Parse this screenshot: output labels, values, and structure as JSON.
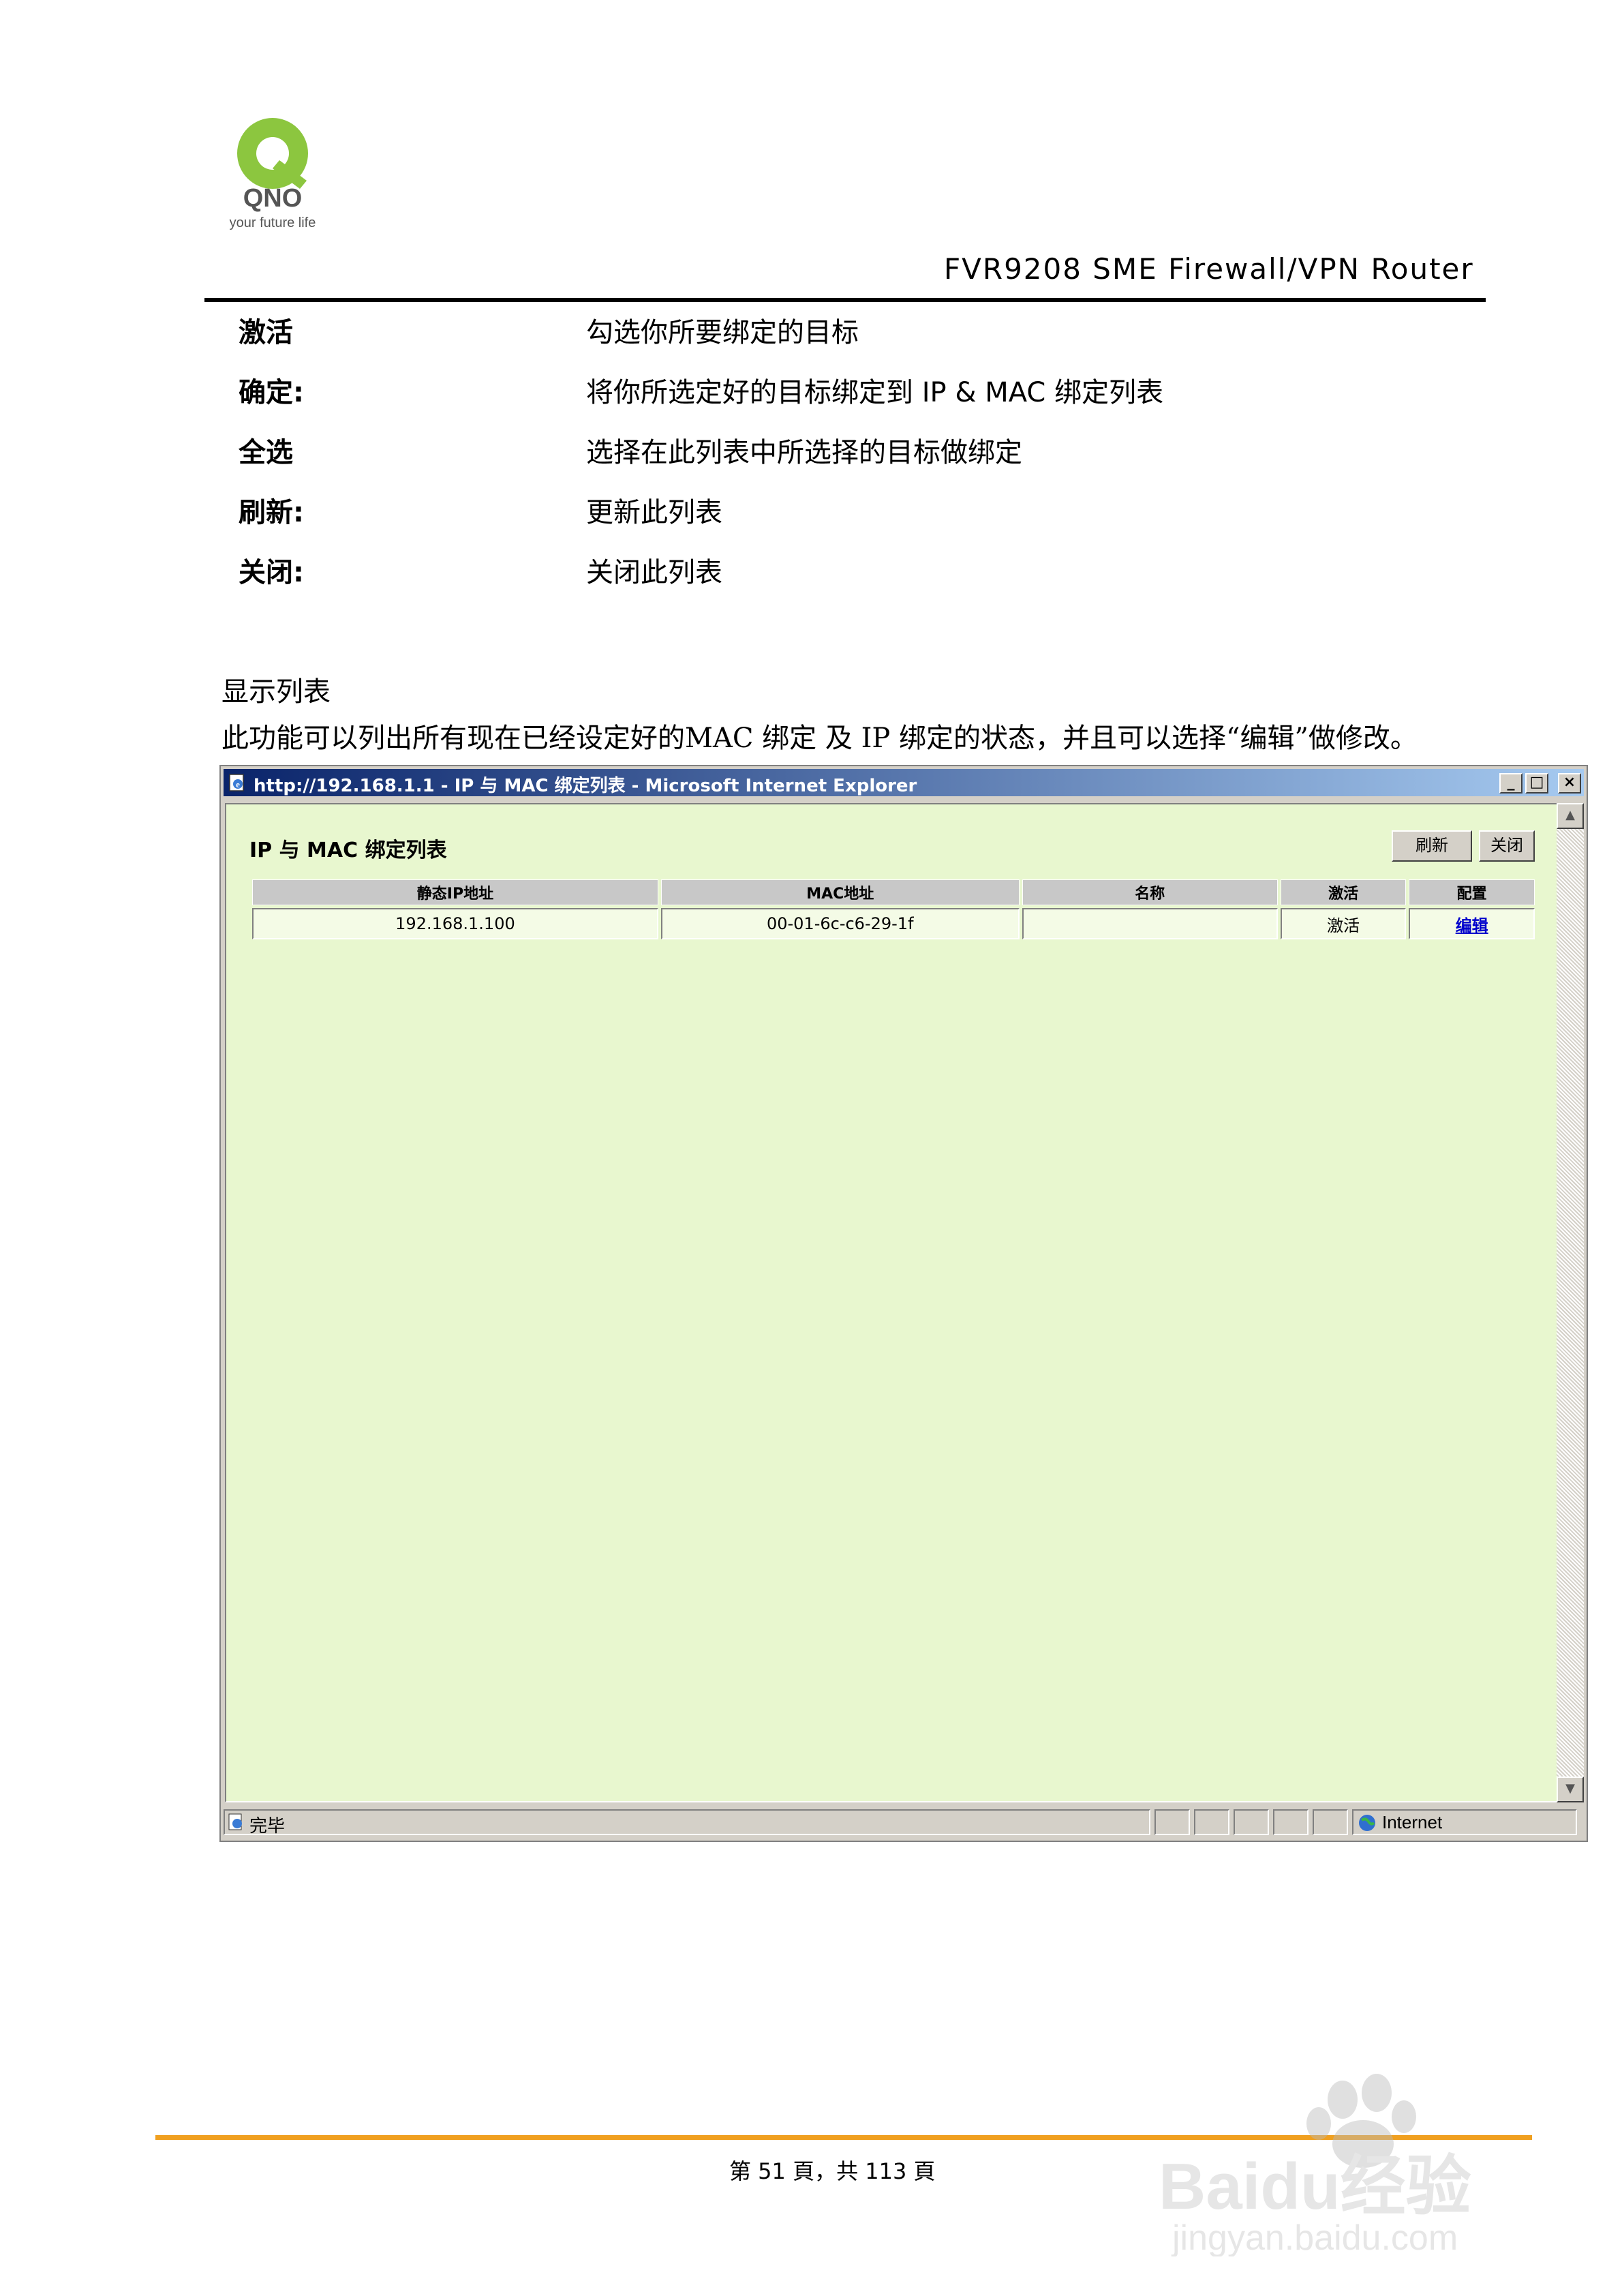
{
  "logo": {
    "brand": "QNO",
    "tagline": "your future life"
  },
  "header": {
    "title": "FVR9208 SME Firewall/VPN Router"
  },
  "definitions": [
    {
      "term": "激活",
      "desc": "勾选你所要绑定的目标"
    },
    {
      "term": "确定:",
      "desc": "将你所选定好的目标绑定到 IP & MAC 绑定列表"
    },
    {
      "term": "全选",
      "desc": "选择在此列表中所选择的目标做绑定"
    },
    {
      "term": "刷新:",
      "desc": "更新此列表"
    },
    {
      "term": "关闭:",
      "desc": "关闭此列表"
    }
  ],
  "section": {
    "title": "显示列表",
    "text": "此功能可以列出所有现在已经设定好的MAC 绑定 及 IP 绑定的状态，并且可以选择“编辑”做修改。"
  },
  "ie": {
    "window_title": "http://192.168.1.1 - IP 与 MAC 绑定列表 - Microsoft Internet Explorer",
    "list_title": "IP 与 MAC 绑定列表",
    "refresh_label": "刷新",
    "close_label": "关闭",
    "columns": [
      "静态IP地址",
      "MAC地址",
      "名称",
      "激活",
      "配置"
    ],
    "rows": [
      {
        "ip": "192.168.1.100",
        "mac": "00-01-6c-c6-29-1f",
        "name": "",
        "active": "激活",
        "config": "编辑"
      }
    ],
    "status_text": "完毕",
    "zone_text": "Internet"
  },
  "footer": {
    "page_text": "第 51 頁，共 113 頁"
  },
  "watermark": {
    "brand": "Baidu经验",
    "url": "jingyan.baidu.com"
  },
  "colors": {
    "content_bg": "#e8f7cf",
    "footer_rule": "#f0a020",
    "title_bar": "#0a246a",
    "link": "#0000cc"
  }
}
